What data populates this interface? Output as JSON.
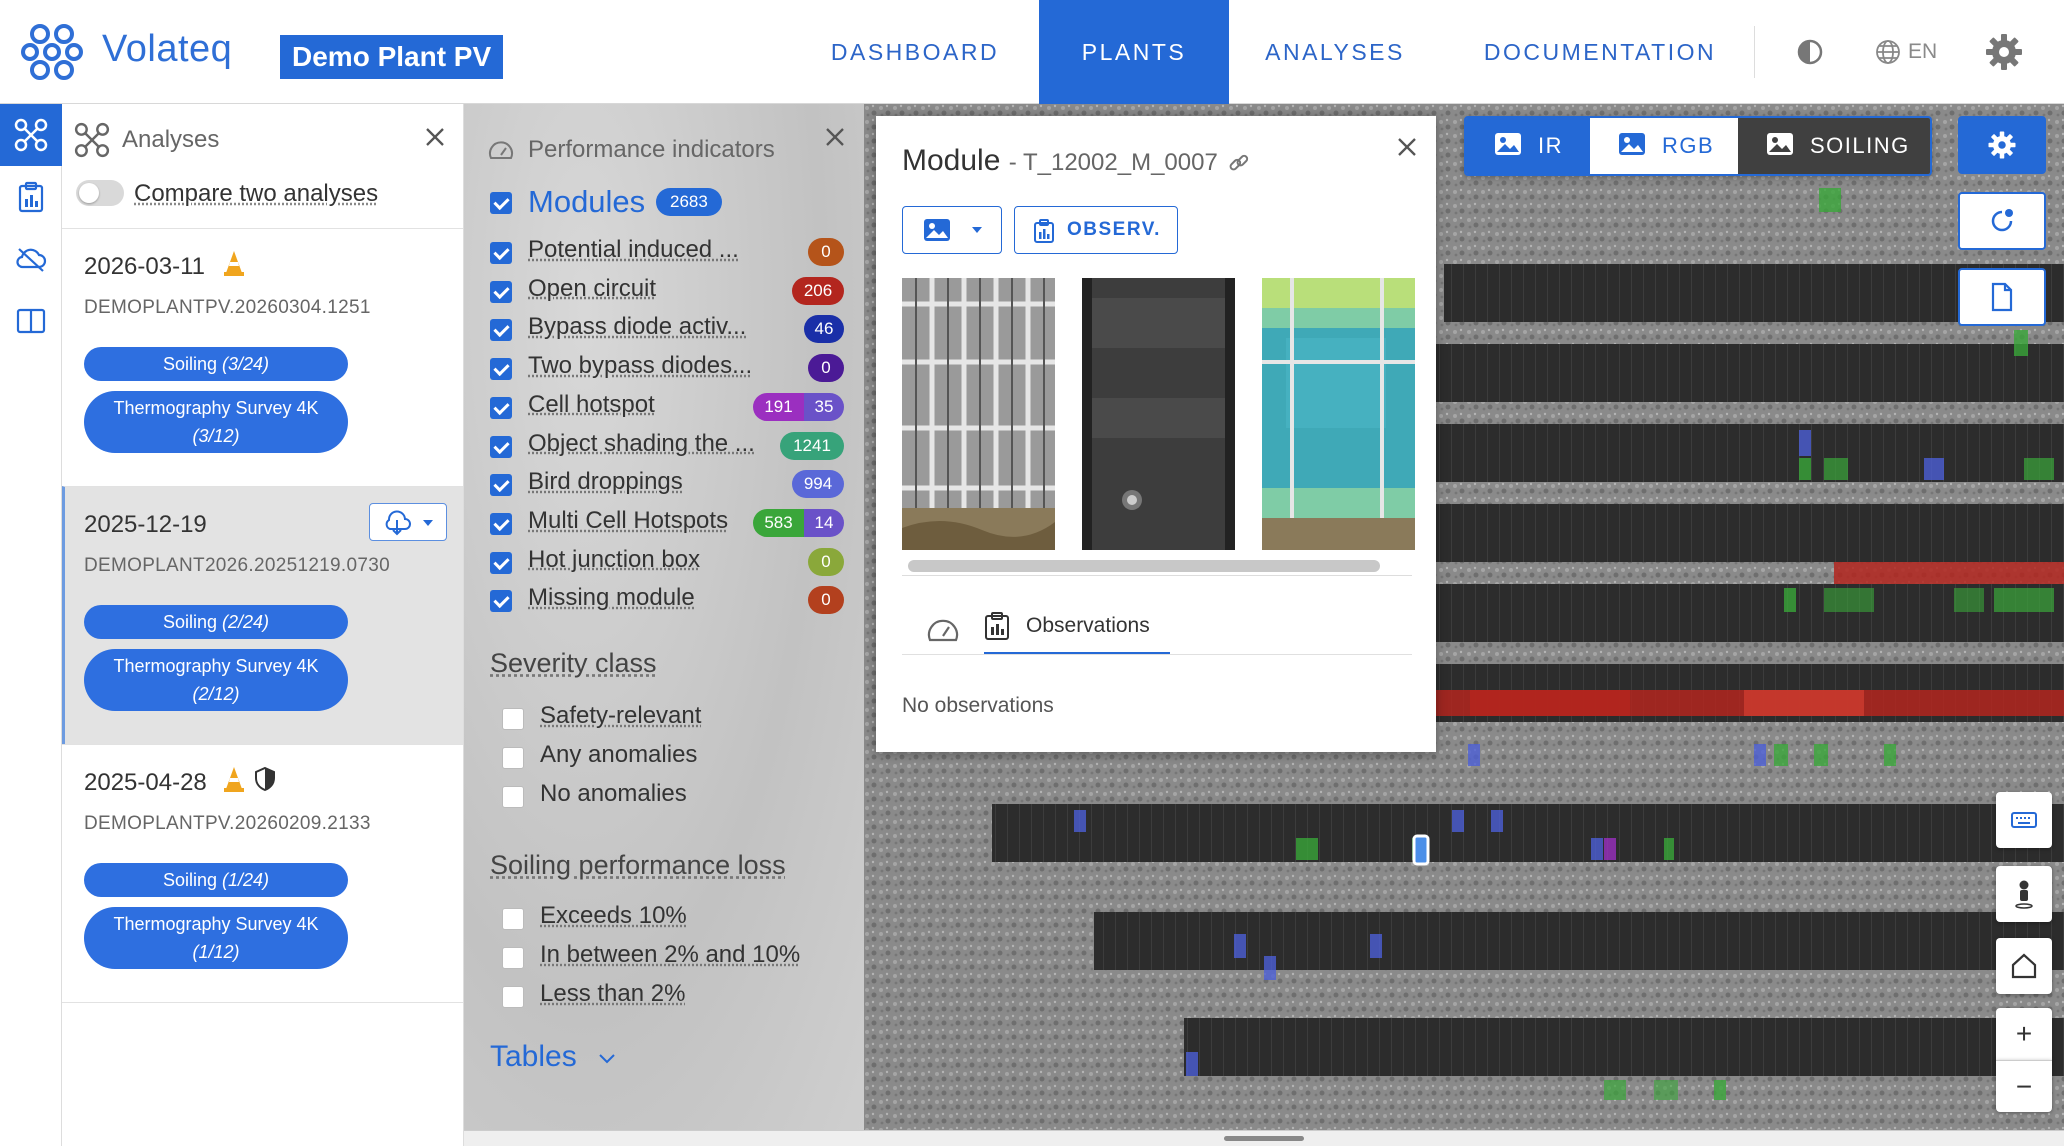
{
  "header": {
    "brand": "Volateq",
    "plant_name": "Demo Plant PV",
    "nav": [
      "DASHBOARD",
      "PLANTS",
      "ANALYSES",
      "DOCUMENTATION"
    ],
    "active_nav": "PLANTS",
    "language": "EN",
    "icons": [
      "volateq-logo-icon",
      "contrast-icon",
      "globe-icon",
      "gear-icon"
    ]
  },
  "rail": {
    "items": [
      "drone-analyses-icon",
      "report-icon",
      "cloud-off-icon",
      "compare-columns-icon"
    ],
    "active": "drone-analyses-icon"
  },
  "analyses_panel": {
    "title": "Analyses",
    "compare_label": "Compare two analyses",
    "compare_enabled": false,
    "items": [
      {
        "date": "2026-03-11",
        "id": "DEMOPLANTPV.20260304.1251",
        "soiling": "Soiling",
        "soiling_count": "(3/24)",
        "thermo": "Thermography Survey 4K",
        "thermo_count": "(3/12)",
        "badges": [
          "cone-icon"
        ]
      },
      {
        "date": "2025-12-19",
        "id": "DEMOPLANT2026.20251219.0730",
        "soiling": "Soiling",
        "soiling_count": "(2/24)",
        "thermo": "Thermography Survey 4K",
        "thermo_count": "(2/12)",
        "badges": [],
        "selected": true
      },
      {
        "date": "2025-04-28",
        "id": "DEMOPLANTPV.20260209.2133",
        "soiling": "Soiling",
        "soiling_count": "(1/24)",
        "thermo": "Thermography Survey 4K",
        "thermo_count": "(1/12)",
        "badges": [
          "cone-icon",
          "shield-icon"
        ]
      }
    ]
  },
  "performance_panel": {
    "title": "Performance indicators",
    "modules_label": "Modules",
    "modules_count": "2683",
    "indicators": [
      {
        "label": "Potential induced ...",
        "counts": [
          "0"
        ],
        "colors": [
          "#b5541a"
        ]
      },
      {
        "label": "Open circuit",
        "counts": [
          "206"
        ],
        "colors": [
          "#b3261e"
        ]
      },
      {
        "label": "Bypass diode activ...",
        "counts": [
          "46"
        ],
        "colors": [
          "#1a2fa8"
        ]
      },
      {
        "label": "Two bypass diodes...",
        "counts": [
          "0"
        ],
        "colors": [
          "#4b1a96"
        ]
      },
      {
        "label": "Cell hotspot",
        "counts": [
          "191",
          "35"
        ],
        "colors": [
          "#9b2fc0",
          "#6a52c8"
        ]
      },
      {
        "label": "Object shading the ...",
        "counts": [
          "1241"
        ],
        "colors": [
          "#37a37a"
        ]
      },
      {
        "label": "Bird droppings",
        "counts": [
          "994"
        ],
        "colors": [
          "#5a68d8"
        ]
      },
      {
        "label": "Multi Cell Hotspots",
        "counts": [
          "583",
          "14"
        ],
        "colors": [
          "#3aa63a",
          "#6a52c8"
        ]
      },
      {
        "label": "Hot junction box",
        "counts": [
          "0"
        ],
        "colors": [
          "#8aa83a"
        ]
      },
      {
        "label": "Missing module",
        "counts": [
          "0"
        ],
        "colors": [
          "#b3401e"
        ]
      }
    ],
    "severity_title": "Severity class",
    "severity_options": [
      "Safety-relevant",
      "Any anomalies",
      "No anomalies"
    ],
    "soiling_title": "Soiling performance loss",
    "soiling_options": [
      "Exceeds 10%",
      "In between 2% and 10%",
      "Less than 2%"
    ],
    "tables_label": "Tables"
  },
  "module_popup": {
    "title": "Module",
    "module_id": "- T_12002_M_0007",
    "observations_button": "OBSERV.",
    "tab_label": "Observations",
    "empty_text": "No observations",
    "images": [
      "rgb-module-image",
      "ir-module-image",
      "soiling-module-image"
    ]
  },
  "map": {
    "layers": [
      "IR",
      "RGB",
      "SOILING"
    ],
    "active_layer": "IR",
    "controls": [
      "keyboard-icon",
      "pegman-icon",
      "home-icon",
      "zoom-in",
      "zoom-out"
    ],
    "zoom_in": "+",
    "zoom_out": "−"
  }
}
